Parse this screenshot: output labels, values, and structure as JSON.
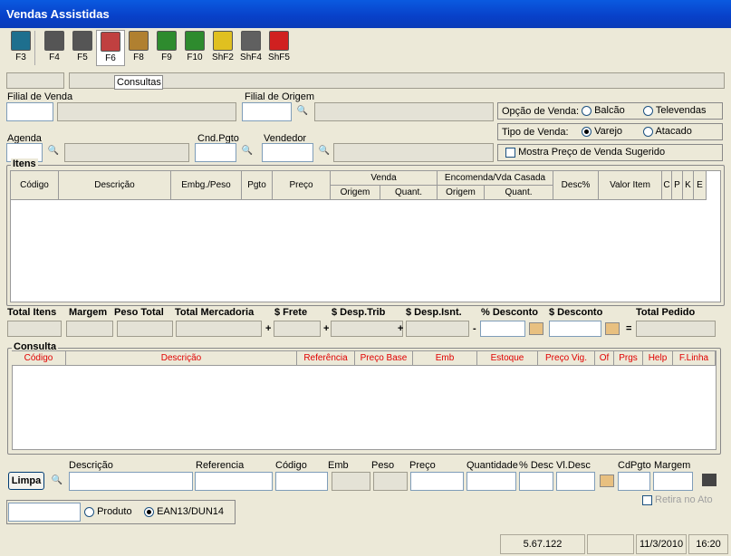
{
  "window": {
    "title": "Vendas Assistidas"
  },
  "toolbar": [
    {
      "key": "F3",
      "icon": "exit-door-icon",
      "color": "#1E6F8E"
    },
    {
      "key": "F4",
      "icon": "document-icon",
      "color": "#555555"
    },
    {
      "key": "F5",
      "icon": "copy-icon",
      "color": "#555555"
    },
    {
      "key": "F6",
      "icon": "printer-icon",
      "color": "#C04040"
    },
    {
      "key": "F8",
      "icon": "tools-icon",
      "color": "#B08030"
    },
    {
      "key": "F9",
      "icon": "money-icon",
      "color": "#2E8B2E"
    },
    {
      "key": "F10",
      "icon": "chart-icon",
      "color": "#2E8B2E"
    },
    {
      "key": "ShF2",
      "icon": "lightbulb-icon",
      "color": "#E0C020"
    },
    {
      "key": "ShF4",
      "icon": "trash-icon",
      "color": "#606060"
    },
    {
      "key": "ShF5",
      "icon": "phone-icon",
      "color": "#D02020"
    }
  ],
  "tab": {
    "label": "Consultas"
  },
  "labels": {
    "filial_venda": "Filial de Venda",
    "filial_origem": "Filial de Origem",
    "agenda": "Agenda",
    "cnd_pgto": "Cnd.Pgto",
    "vendedor": "Vendedor"
  },
  "opcao_venda": {
    "label": "Opção de Venda:",
    "options": [
      "Balcão",
      "Televendas"
    ],
    "selected": ""
  },
  "tipo_venda": {
    "label": "Tipo de Venda:",
    "options": [
      "Varejo",
      "Atacado"
    ],
    "selected": "Varejo"
  },
  "mostra_preco": {
    "label": "Mostra Preço de Venda Sugerido"
  },
  "itens": {
    "legend": "Itens",
    "headers": {
      "codigo": "Código",
      "descricao": "Descrição",
      "embg": "Embg./Peso",
      "pgto": "Pgto",
      "preco": "Preço",
      "venda": "Venda",
      "encomenda": "Encomenda/Vda Casada",
      "origem": "Origem",
      "quant": "Quant.",
      "origem2": "Origem",
      "quant2": "Quant.",
      "desc": "Desc%",
      "valor": "Valor Item",
      "c": "C",
      "p": "P",
      "k": "K",
      "e": "E"
    }
  },
  "totals": {
    "total_itens": "Total Itens",
    "margem": "Margem",
    "peso_total": "Peso Total",
    "total_mercadoria": "Total Mercadoria",
    "frete": "$ Frete",
    "desp_trib": "$ Desp.Trib",
    "desp_isnt": "$ Desp.Isnt.",
    "pct_desconto": "% Desconto",
    "desconto": "$ Desconto",
    "total_pedido": "Total Pedido",
    "op_plus": "+",
    "op_minus": "-",
    "op_eq": "="
  },
  "consulta": {
    "legend": "Consulta",
    "headers": [
      "Código",
      "Descrição",
      "Referência",
      "Preço Base",
      "Emb",
      "Estoque",
      "Preço Vig.",
      "Of",
      "Prgs",
      "Help",
      "F.Linha"
    ]
  },
  "search": {
    "limpa": "Limpa",
    "descricao": "Descrição",
    "referencia": "Referencia",
    "codigo": "Código",
    "emb": "Emb",
    "peso": "Peso",
    "preco": "Preço",
    "quantidade": "Quantidade",
    "pct_desc": "% Desc",
    "vl_desc": "Vl.Desc",
    "cdpgto": "CdPgto",
    "margem": "Margem",
    "retira": "Retira no Ato"
  },
  "product_mode": {
    "options": [
      "Produto",
      "EAN13/DUN14"
    ],
    "selected": "EAN13/DUN14"
  },
  "statusbar": {
    "version": "5.67.122",
    "date": "11/3/2010",
    "time": "16:20"
  }
}
